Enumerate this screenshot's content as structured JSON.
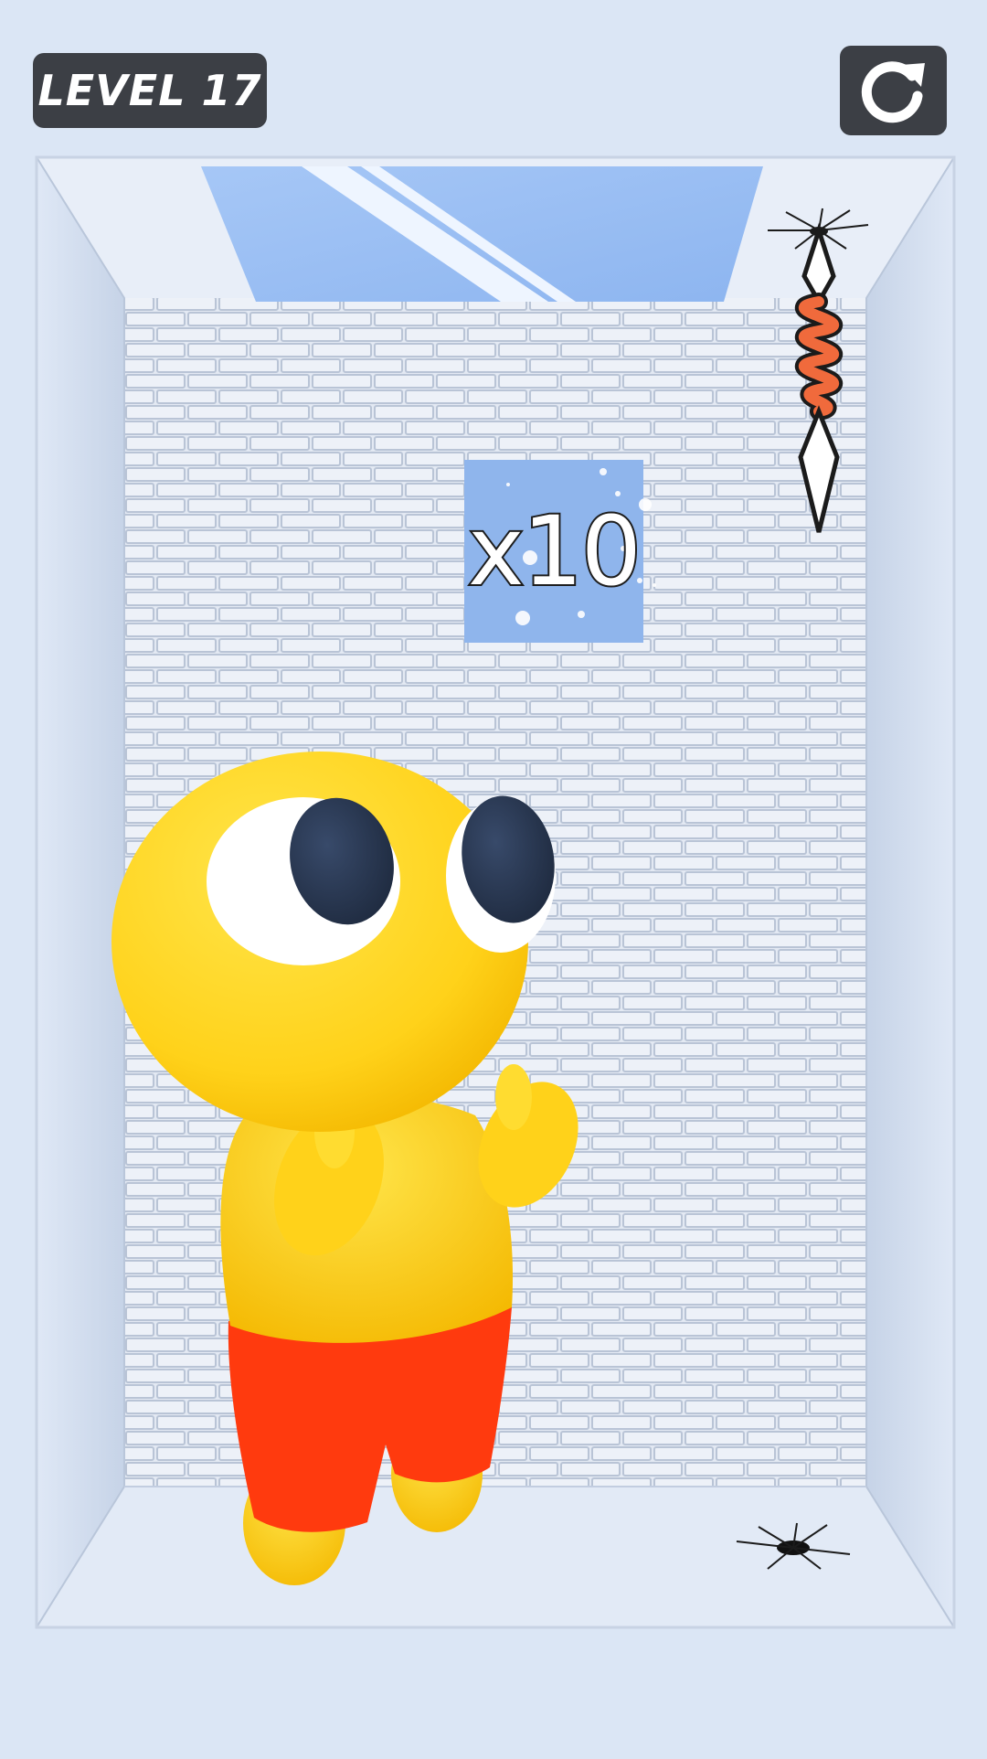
{
  "hud": {
    "level_label": "LEVEL 17",
    "restart_icon": "restart-arrow-icon"
  },
  "scene": {
    "multiplier_label": "x10",
    "character": "yellow-round-head-character",
    "hazard": "spring-spike-trap",
    "floor_mark": "crack-hole"
  },
  "colors": {
    "background": "#dbe6f5",
    "hud_panel": "#3c3f45",
    "character_yellow": "#ffd21a",
    "shorts_red": "#ff3a0e",
    "multiplier_tile": "#8fb5ec",
    "spring_orange": "#f06a3c"
  }
}
